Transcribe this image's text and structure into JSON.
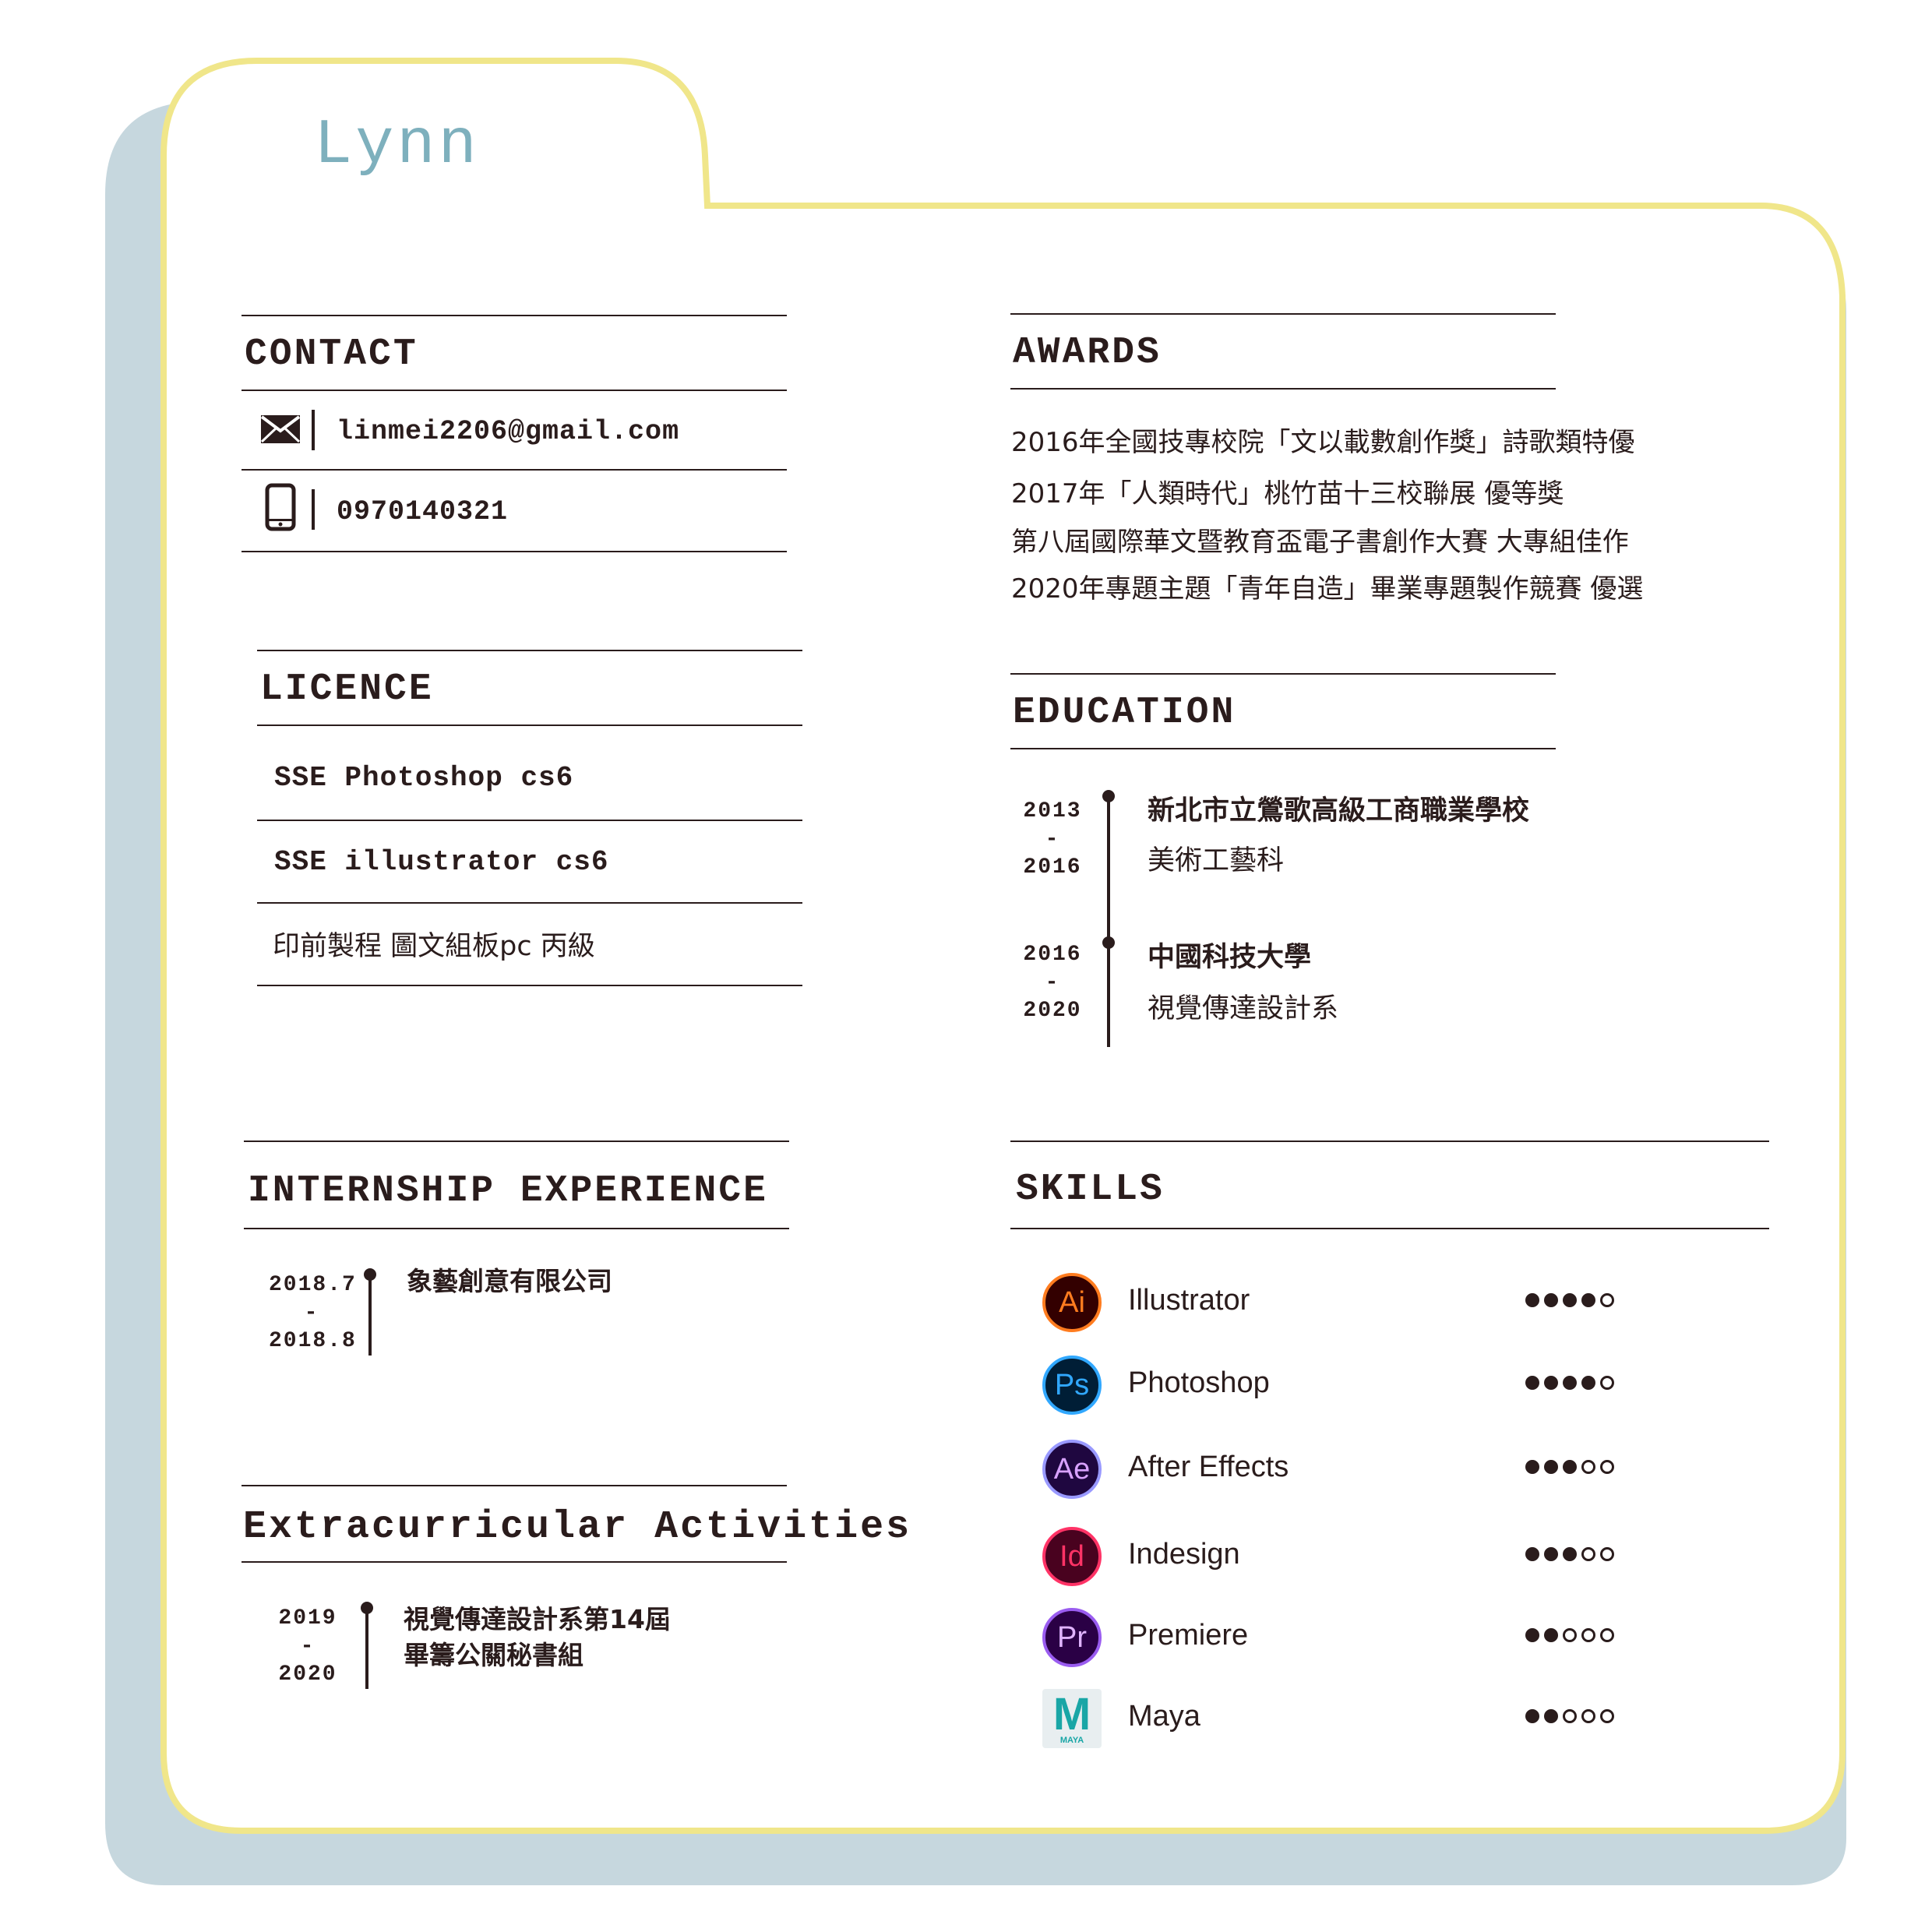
{
  "name": "Lynn",
  "colors": {
    "accent": "#7eb0bd",
    "frame": "#f0e68a",
    "shadow": "#c6d7de",
    "ink": "#2a1c1c"
  },
  "contact": {
    "heading": "CONTACT",
    "email": "linmei2206@gmail.com",
    "phone": "0970140321",
    "email_icon": "envelope-icon",
    "phone_icon": "phone-icon"
  },
  "licence": {
    "heading": "LICENCE",
    "items": [
      "SSE Photoshop cs6",
      "SSE illustrator cs6",
      "印前製程 圖文組板pc 丙級"
    ]
  },
  "internship": {
    "heading": "INTERNSHIP EXPERIENCE",
    "start": "2018.7",
    "dash": "-",
    "end": "2018.8",
    "company": "象藝創意有限公司"
  },
  "extracurricular": {
    "heading": "Extracurricular Activities",
    "start": "2019",
    "dash": "-",
    "end": "2020",
    "line1": "視覺傳達設計系第14屆",
    "line2": "畢籌公關秘書組"
  },
  "awards": {
    "heading": "AWARDS",
    "items": [
      "2016年全國技專校院「文以載數創作獎」詩歌類特優",
      "2017年「人類時代」桃竹苗十三校聯展 優等獎",
      "第八屆國際華文暨教育盃電子書創作大賽 大專組佳作",
      "2020年專題主題「青年自造」畢業專題製作競賽 優選"
    ]
  },
  "education": {
    "heading": "EDUCATION",
    "entries": [
      {
        "start": "2013",
        "dash": "-",
        "end": "2016",
        "school": "新北市立鶯歌高級工商職業學校",
        "dept": "美術工藝科"
      },
      {
        "start": "2016",
        "dash": "-",
        "end": "2020",
        "school": "中國科技大學",
        "dept": "視覺傳達設計系"
      }
    ]
  },
  "skills": {
    "heading": "SKILLS",
    "items": [
      {
        "abbr": "Ai",
        "name": "Illustrator",
        "rating": 4,
        "max": 5,
        "icon": "illustrator-icon",
        "fg": "#ff7c1f",
        "bg": "#330000",
        "ring": "#ff7c1f"
      },
      {
        "abbr": "Ps",
        "name": "Photoshop",
        "rating": 4,
        "max": 5,
        "icon": "photoshop-icon",
        "fg": "#31a8ff",
        "bg": "#001e36",
        "ring": "#31a8ff"
      },
      {
        "abbr": "Ae",
        "name": "After Effects",
        "rating": 3,
        "max": 5,
        "icon": "after-effects-icon",
        "fg": "#d8a1ff",
        "bg": "#1f0740",
        "ring": "#9999ff"
      },
      {
        "abbr": "Id",
        "name": "Indesign",
        "rating": 3,
        "max": 5,
        "icon": "indesign-icon",
        "fg": "#ff3366",
        "bg": "#49021f",
        "ring": "#ff3366"
      },
      {
        "abbr": "Pr",
        "name": "Premiere",
        "rating": 2,
        "max": 5,
        "icon": "premiere-icon",
        "fg": "#e0b3ff",
        "bg": "#2a0045",
        "ring": "#9a5cf0"
      },
      {
        "abbr": "M",
        "name": "Maya",
        "rating": 2,
        "max": 5,
        "icon": "maya-icon",
        "fg": "#19a6a6",
        "bg": "#e8eef0",
        "ring": "#e8eef0",
        "sub": "MAYA"
      }
    ]
  }
}
